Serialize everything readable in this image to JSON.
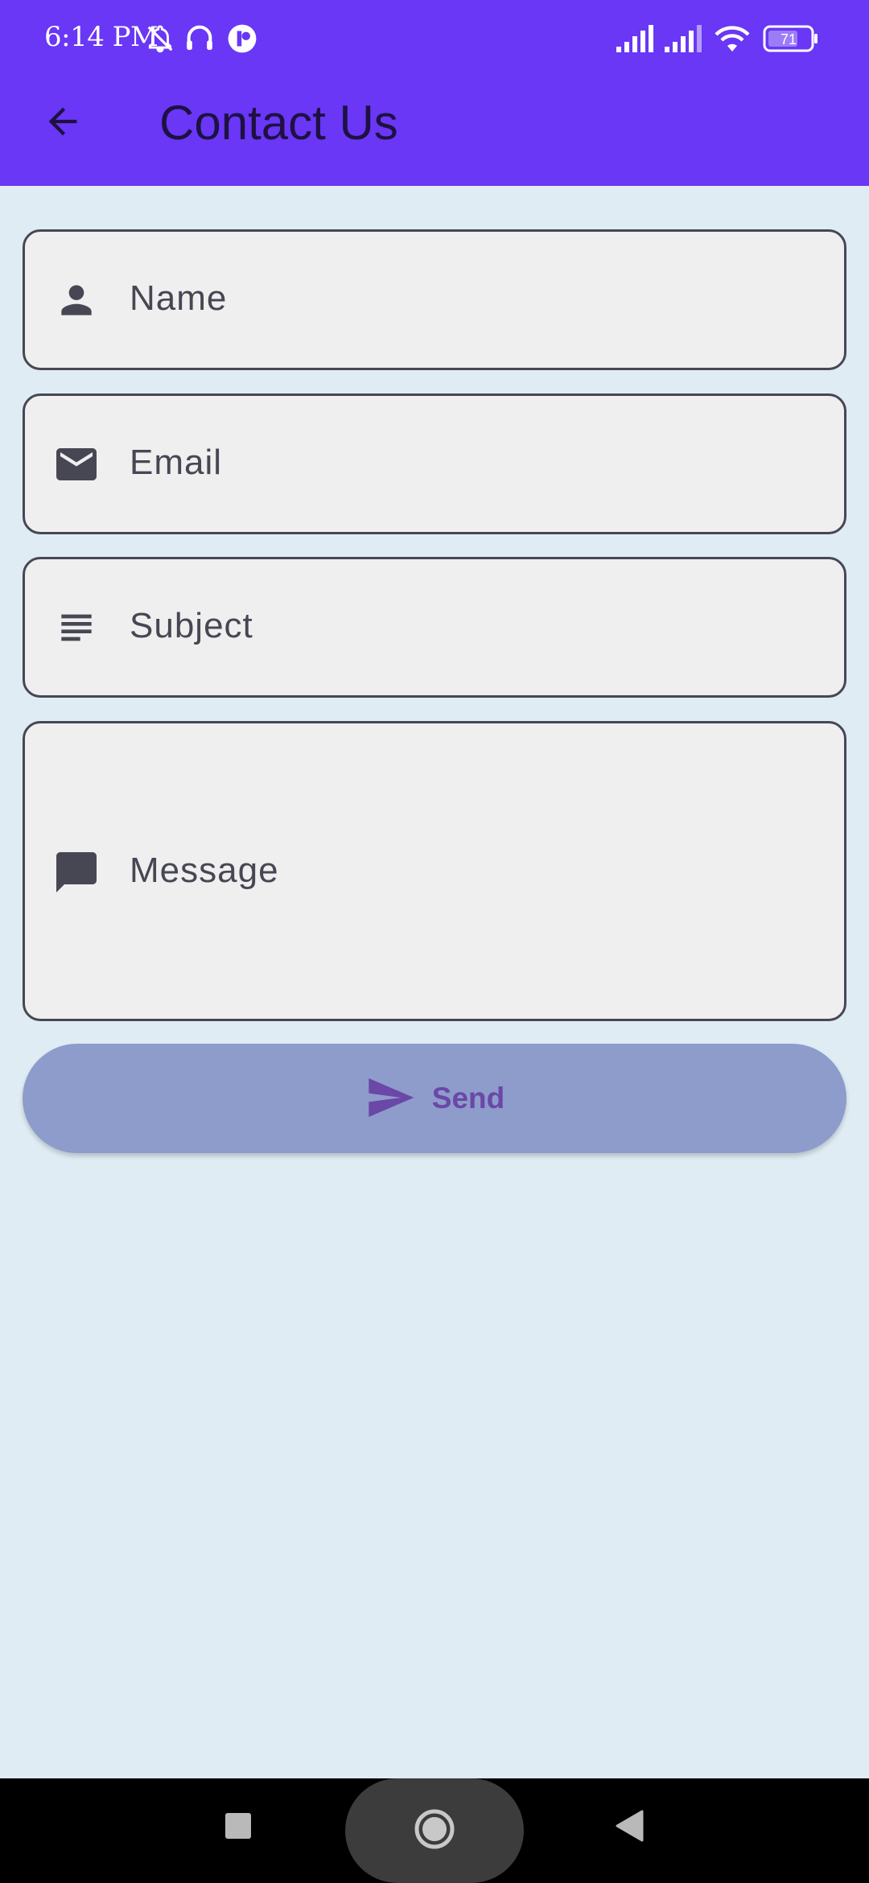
{
  "status_bar": {
    "time": "6:14 PM",
    "icons": [
      "bell-off-icon",
      "headphones-icon",
      "app-notification-icon",
      "signal-icon",
      "signal-icon",
      "wifi-icon",
      "battery-icon"
    ],
    "battery_level": "71"
  },
  "app_bar": {
    "title": "Contact Us",
    "back_icon": "arrow-back-icon",
    "background_color": "#6937f5"
  },
  "form": {
    "fields": [
      {
        "icon": "person-icon",
        "placeholder": "Name",
        "value": ""
      },
      {
        "icon": "email-icon",
        "placeholder": "Email",
        "value": ""
      },
      {
        "icon": "subject-icon",
        "placeholder": "Subject",
        "value": ""
      },
      {
        "icon": "message-icon",
        "placeholder": "Message",
        "value": ""
      }
    ],
    "send_button": {
      "label": "Send",
      "icon": "send-icon",
      "color": "#8d9ccb"
    }
  },
  "nav_bar": {
    "buttons": [
      "recents-square-icon",
      "home-circle-icon",
      "back-triangle-icon"
    ]
  }
}
